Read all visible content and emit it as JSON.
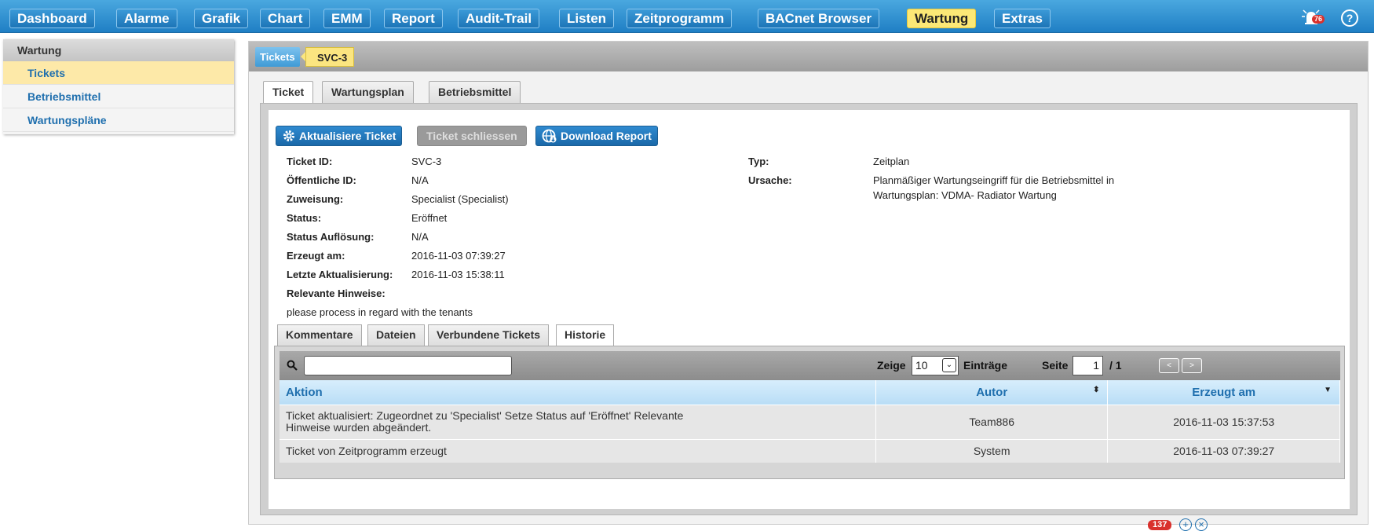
{
  "nav": {
    "items": [
      "Dashboard",
      "Alarme",
      "Grafik",
      "Chart",
      "EMM",
      "Report",
      "Audit-Trail",
      "Listen",
      "Zeitprogramm",
      "BACnet Browser",
      "Wartung",
      "Extras"
    ],
    "active": "Wartung",
    "bell_count": "76",
    "help_label": "?"
  },
  "sidebar": {
    "title": "Wartung",
    "items": [
      {
        "label": "Tickets",
        "active": true
      },
      {
        "label": "Betriebsmittel",
        "active": false
      },
      {
        "label": "Wartungspläne",
        "active": false
      }
    ]
  },
  "breadcrumb": {
    "root": "Tickets",
    "current": "SVC-3"
  },
  "tabs": [
    "Ticket",
    "Wartungsplan",
    "Betriebsmittel"
  ],
  "actions": {
    "update": "Aktualisiere Ticket",
    "close": "Ticket schliessen",
    "download": "Download Report"
  },
  "ticket": {
    "fields": [
      {
        "label": "Ticket ID:",
        "value": "SVC-3"
      },
      {
        "label": "Öffentliche ID:",
        "value": "N/A"
      },
      {
        "label": "Zuweisung:",
        "value": "Specialist (Specialist)"
      },
      {
        "label": "Status:",
        "value": "Eröffnet"
      },
      {
        "label": "Status Auflösung:",
        "value": "N/A"
      },
      {
        "label": "Erzeugt am:",
        "value": "2016-11-03 07:39:27"
      },
      {
        "label": "Letzte Aktualisierung:",
        "value": "2016-11-03 15:38:11"
      }
    ],
    "hint_label": "Relevante Hinweise:",
    "hint_text": "please process in regard with the tenants",
    "typ_label": "Typ:",
    "typ_value": "Zeitplan",
    "ursache_label": "Ursache:",
    "ursache_line1": "Planmäßiger Wartungseingriff für die Betriebsmittel in",
    "ursache_line2": "Wartungsplan: VDMA- Radiator Wartung"
  },
  "subtabs": [
    "Kommentare",
    "Dateien",
    "Verbundene Tickets",
    "Historie"
  ],
  "grid": {
    "search_value": "",
    "show_label": "Zeige",
    "show_value": "10",
    "entries_label": "Einträge",
    "page_label": "Seite",
    "page_value": "1",
    "page_total": "/ 1",
    "prev": "<",
    "next": ">",
    "columns": [
      "Aktion",
      "Autor",
      "Erzeugt am"
    ],
    "rows": [
      {
        "aktion1": "Ticket aktualisiert: Zugeordnet zu 'Specialist' Setze Status auf 'Eröffnet' Relevante",
        "aktion2": "Hinweise wurden abgeändert.",
        "autor": "Team886",
        "erzeugt": "2016-11-03 15:37:53"
      },
      {
        "aktion1": "Ticket von Zeitprogramm erzeugt",
        "aktion2": "",
        "autor": "System",
        "erzeugt": "2016-11-03 07:39:27"
      }
    ]
  },
  "footer": {
    "badge": "137",
    "plus": "+",
    "close": "×"
  }
}
